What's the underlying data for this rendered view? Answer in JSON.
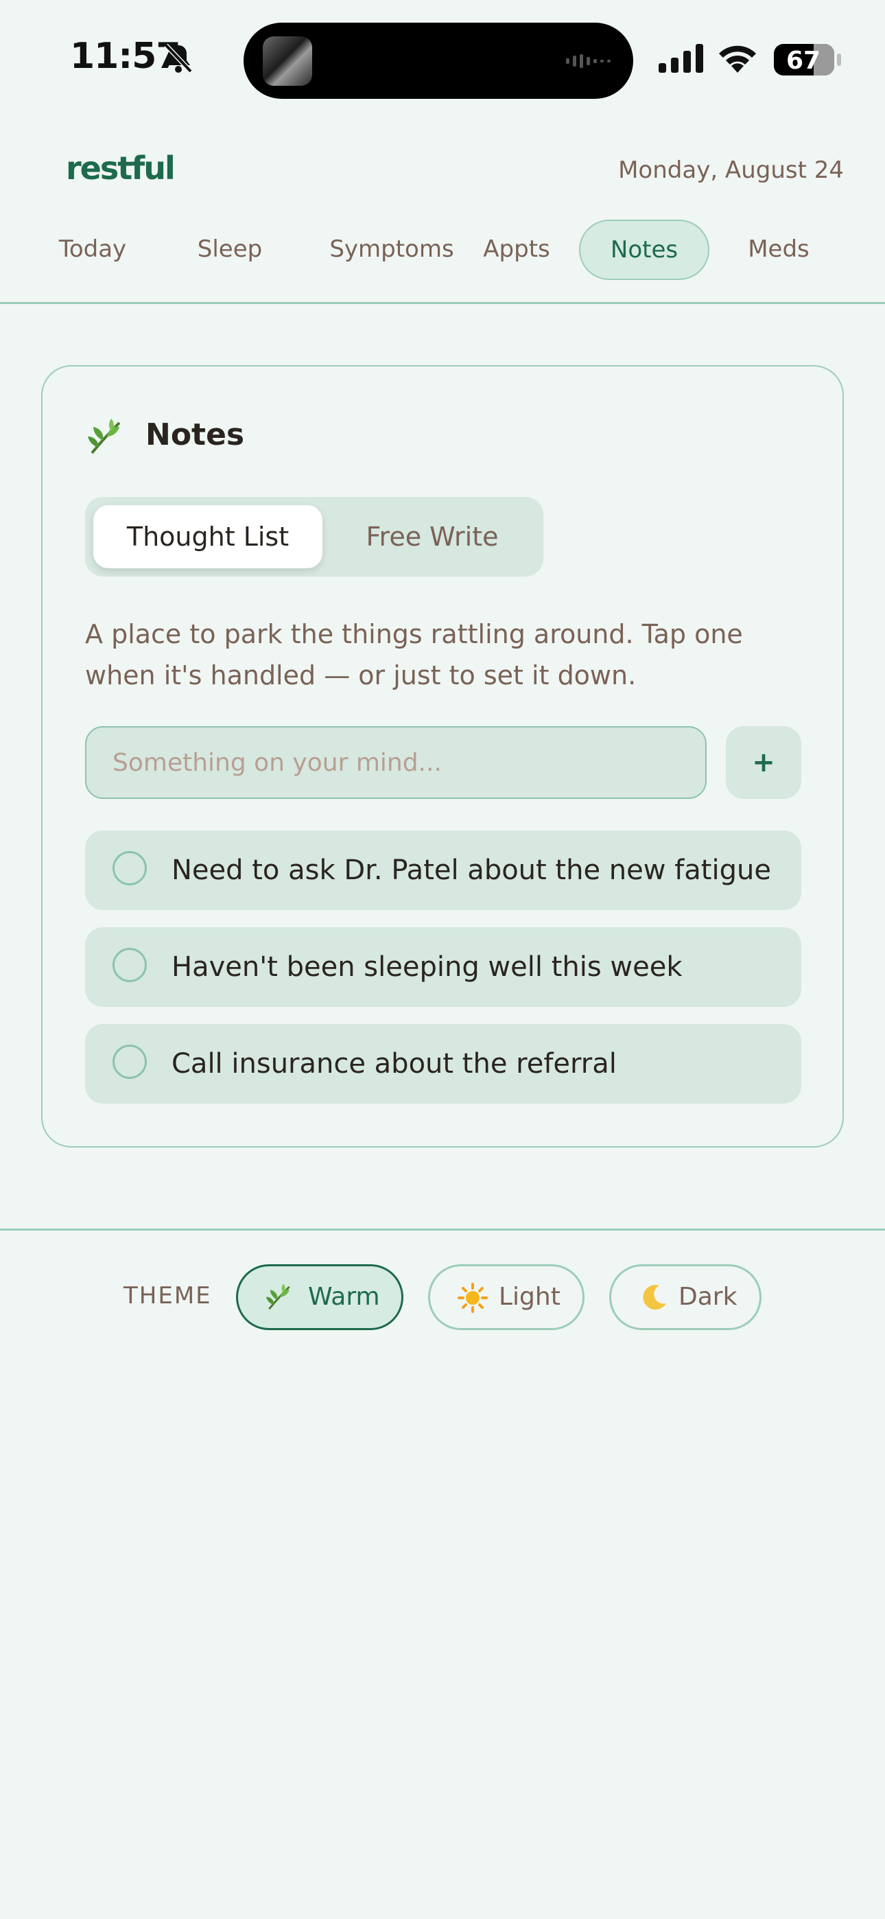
{
  "status_bar": {
    "time": "11:57",
    "battery": "67"
  },
  "header": {
    "logo": "restful",
    "date": "Monday, August 24"
  },
  "nav": {
    "items": [
      "Today",
      "Sleep",
      "Symptoms",
      "Appts",
      "Notes",
      "Meds"
    ],
    "active": "Notes"
  },
  "card": {
    "title": "Notes",
    "title_icon": "leaf-icon",
    "segments": {
      "active": "Thought List",
      "inactive": "Free Write"
    },
    "description": "A place to park the things rattling around. Tap one when it's handled — or just to set it down.",
    "input_placeholder": "Something on your mind...",
    "add_label": "+",
    "items": [
      "Need to ask Dr. Patel about the new fatigue",
      "Haven't been sleeping well this week",
      "Call insurance about the referral"
    ]
  },
  "theme": {
    "label": "THEME",
    "options": [
      {
        "icon": "leaf-icon",
        "label": "Warm"
      },
      {
        "icon": "sun-icon",
        "label": "Light"
      },
      {
        "icon": "moon-icon",
        "label": "Dark"
      }
    ],
    "active": "Warm"
  },
  "colors": {
    "accent": "#1d6a4c",
    "border": "#9ccdb9",
    "background": "#f0f6f3",
    "surface": "#d6e8e0",
    "muted_text": "#7a6256"
  }
}
